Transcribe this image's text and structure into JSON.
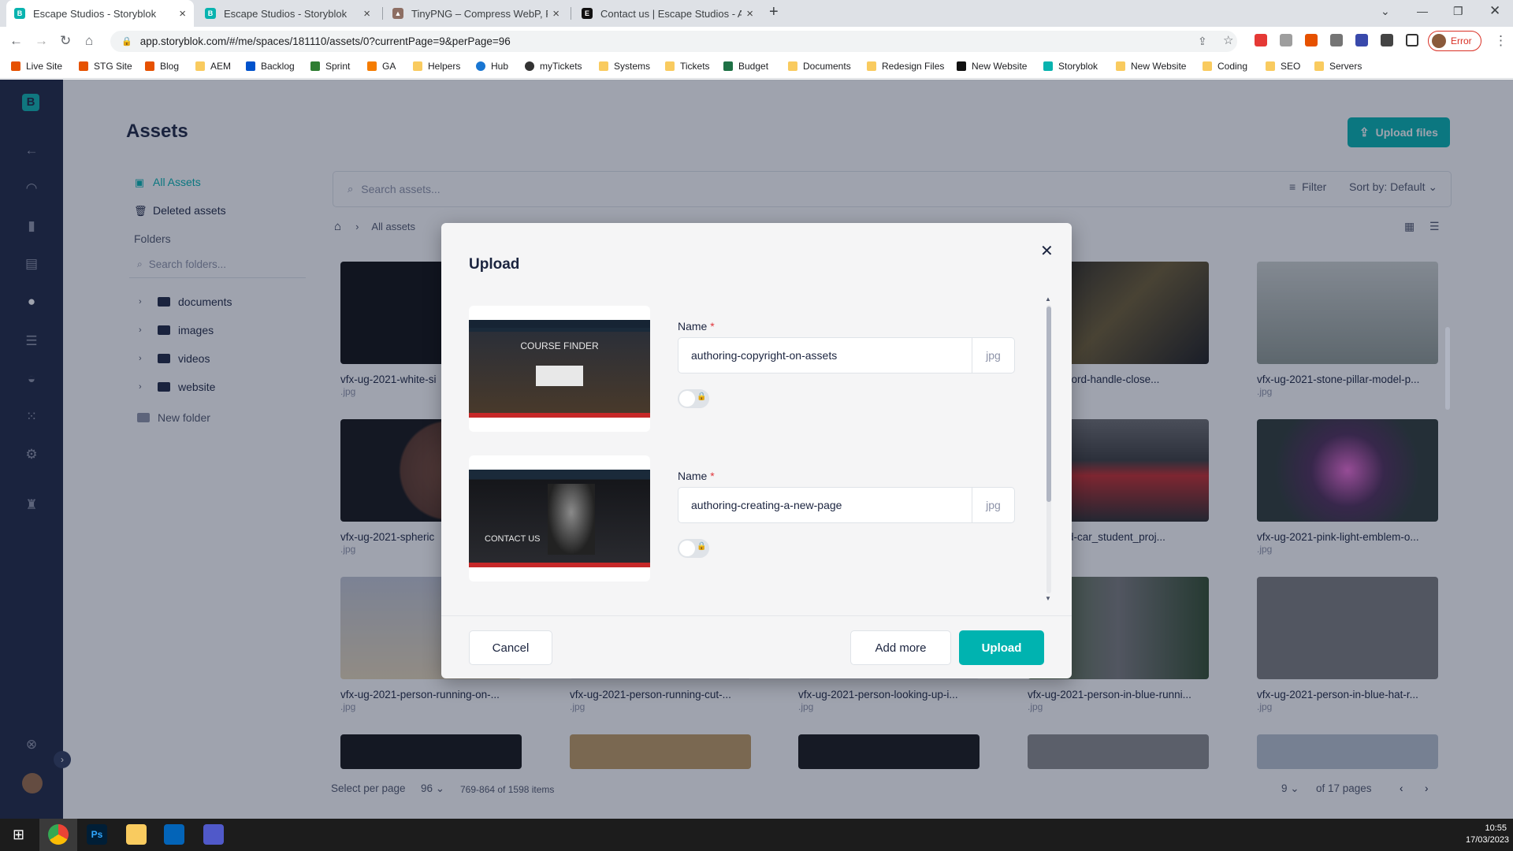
{
  "browser": {
    "tabs": [
      {
        "title": "Escape Studios - Storyblok",
        "active": true
      },
      {
        "title": "Escape Studios - Storyblok",
        "active": false
      },
      {
        "title": "TinyPNG – Compress WebP, PNG",
        "active": false
      },
      {
        "title": "Contact us | Escape Studios - An",
        "active": false
      }
    ],
    "url": "app.storyblok.com/#/me/spaces/181110/assets/0?currentPage=9&perPage=96",
    "profile_label": "Error",
    "bookmarks": [
      "Live Site",
      "STG Site",
      "Blog",
      "AEM",
      "Backlog",
      "Sprint",
      "GA",
      "Helpers",
      "Hub",
      "myTickets",
      "Systems",
      "Tickets",
      "Budget",
      "Documents",
      "Redesign Files",
      "New Website",
      "Storyblok",
      "New Website",
      "Coding",
      "SEO",
      "Servers"
    ]
  },
  "app": {
    "logo": "B",
    "title": "Assets",
    "upload_files": "Upload files",
    "nav": {
      "all_assets": "All Assets",
      "deleted_assets": "Deleted assets",
      "folders": "Folders"
    },
    "folder_search_placeholder": "Search folders...",
    "folders": [
      "documents",
      "images",
      "videos",
      "website"
    ],
    "new_folder": "New folder",
    "search_placeholder": "Search assets...",
    "filter": "Filter",
    "sort": "Sort by: Default",
    "breadcrumb": "All assets",
    "assets": [
      {
        "name": "vfx-ug-2021-white-si",
        "ext": ".jpg"
      },
      {
        "name": "-2021-sword-handle-close...",
        "ext": ""
      },
      {
        "name": "vfx-ug-2021-stone-pillar-model-p...",
        "ext": ".jpg"
      },
      {
        "name": "vfx-ug-2021-spheric",
        "ext": ".jpg"
      },
      {
        "name": "-2021-red-car_student_proj...",
        "ext": ""
      },
      {
        "name": "vfx-ug-2021-pink-light-emblem-o...",
        "ext": ".jpg"
      },
      {
        "name": "vfx-ug-2021-person-running-on-...",
        "ext": ".jpg"
      },
      {
        "name": "vfx-ug-2021-person-running-cut-...",
        "ext": ".jpg"
      },
      {
        "name": "vfx-ug-2021-person-looking-up-i...",
        "ext": ".jpg"
      },
      {
        "name": "vfx-ug-2021-person-in-blue-runni...",
        "ext": ".jpg"
      },
      {
        "name": "vfx-ug-2021-person-in-blue-hat-r...",
        "ext": ".jpg"
      }
    ],
    "pagination": {
      "per_page_label": "Select per page",
      "per_page": "96",
      "range": "769-864 of 1598 items",
      "page": "9",
      "of_pages": "of 17 pages"
    }
  },
  "modal": {
    "title": "Upload",
    "items": [
      {
        "label": "Name",
        "value": "authoring-copyright-on-assets",
        "ext": "jpg",
        "preview_text": "COURSE FINDER"
      },
      {
        "label": "Name",
        "value": "authoring-creating-a-new-page",
        "ext": "jpg",
        "preview_text": "CONTACT US"
      }
    ],
    "cancel": "Cancel",
    "add_more": "Add more",
    "upload": "Upload"
  },
  "taskbar": {
    "time": "10:55",
    "date": "17/03/2023"
  },
  "colors": {
    "accent": "#00b3b0",
    "rail": "#1b243f",
    "required": "#e0373c"
  }
}
